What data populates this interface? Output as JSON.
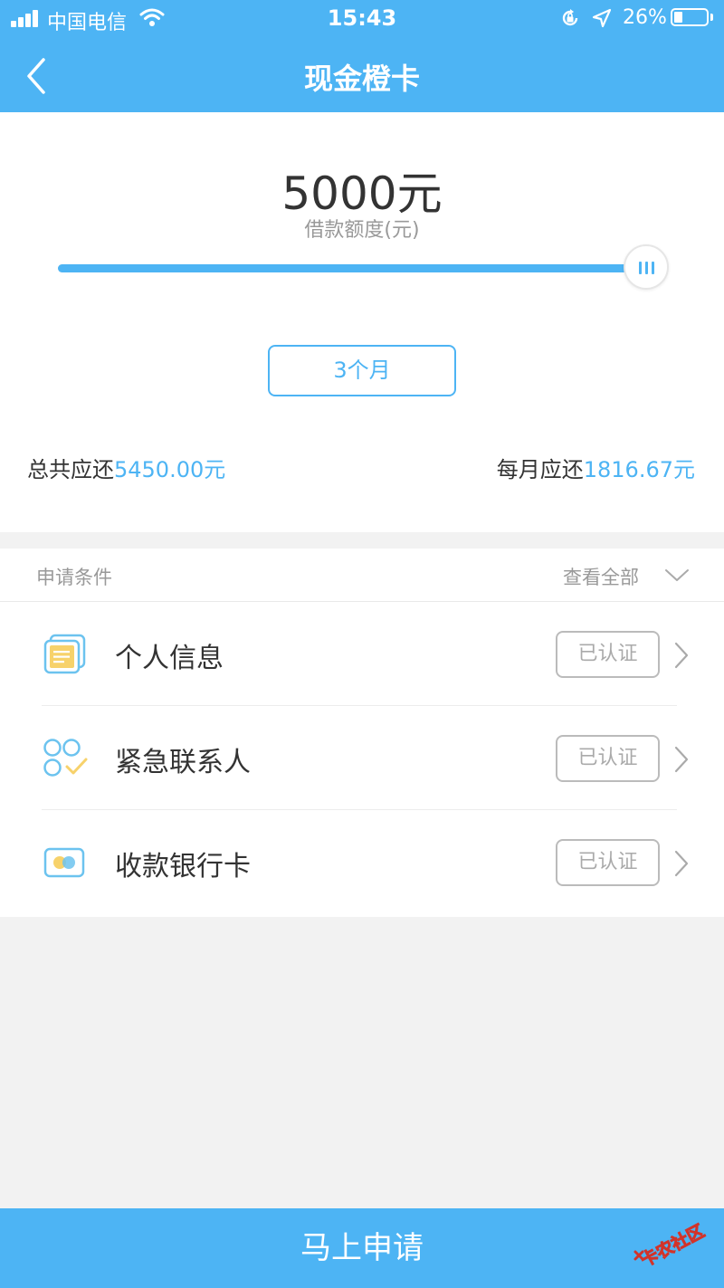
{
  "status_bar": {
    "carrier": "中国电信",
    "time": "15:43",
    "battery_text": "26%",
    "battery_level": 0.26
  },
  "nav": {
    "title": "现金橙卡",
    "back_icon": "chevron-left-icon"
  },
  "loan": {
    "amount": "5000元",
    "amount_label": "借款额度(元)",
    "slider_level": 1.0,
    "term_label": "3个月",
    "total_label": "总共应还",
    "total_value": "5450.00元",
    "monthly_label": "每月应还",
    "monthly_value": "1816.67元"
  },
  "requirements": {
    "title": "申请条件",
    "view_all": "查看全部",
    "items": [
      {
        "label": "个人信息",
        "status": "已认证",
        "icon": "personal-info-icon"
      },
      {
        "label": "紧急联系人",
        "status": "已认证",
        "icon": "emergency-contact-icon"
      },
      {
        "label": "收款银行卡",
        "status": "已认证",
        "icon": "bank-card-icon"
      }
    ]
  },
  "apply_button": "马上申请",
  "watermark": "卡农社区",
  "colors": {
    "primary": "#4db4f4",
    "text": "#333333",
    "muted": "#999999",
    "background": "#f2f2f2",
    "icon_yellow": "#f7d26b"
  }
}
